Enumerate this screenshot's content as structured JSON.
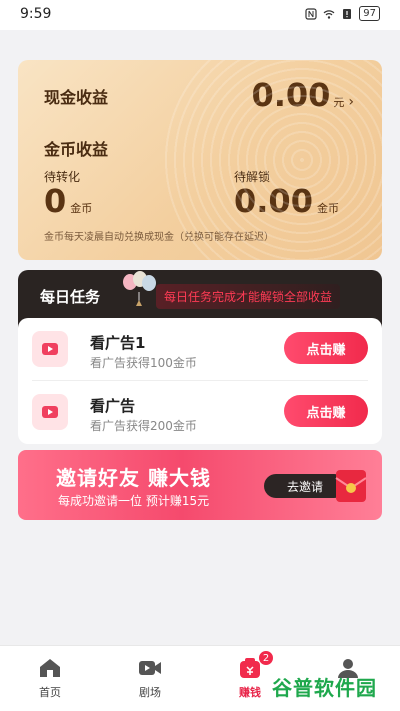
{
  "status": {
    "time": "9:59",
    "battery": "97"
  },
  "earnings": {
    "cash_label": "现金收益",
    "cash_value": "0.00",
    "cash_unit": "元",
    "coin_label": "金币收益",
    "pending_label": "待转化",
    "pending_value": "0",
    "pending_unit": "金币",
    "locked_label": "待解锁",
    "locked_value": "0.00",
    "locked_unit": "金币",
    "note": "金币每天凌晨自动兑换成现金（兑换可能存在延迟）"
  },
  "daily_tasks": {
    "title": "每日任务",
    "subtitle": "每日任务完成才能解锁全部收益",
    "tasks": [
      {
        "name": "看广告1",
        "desc": "看广告获得100金币",
        "button": "点击赚"
      },
      {
        "name": "看广告",
        "desc": "看广告获得200金币",
        "button": "点击赚"
      }
    ]
  },
  "invite": {
    "title": "邀请好友 赚大钱",
    "subtitle": "每成功邀请一位  预计赚15元",
    "button": "去邀请"
  },
  "bottom_nav": {
    "items": [
      {
        "label": "首页",
        "icon": "home-icon"
      },
      {
        "label": "剧场",
        "icon": "video-icon"
      },
      {
        "label": "赚钱",
        "icon": "money-bag-icon",
        "badge": "2",
        "active": true
      },
      {
        "label": "",
        "icon": "profile-icon"
      }
    ]
  },
  "watermark": "谷普软件园",
  "colors": {
    "accent": "#f12a4c",
    "card_gold": "#f3cf9f",
    "dark_header": "#2a2422"
  }
}
